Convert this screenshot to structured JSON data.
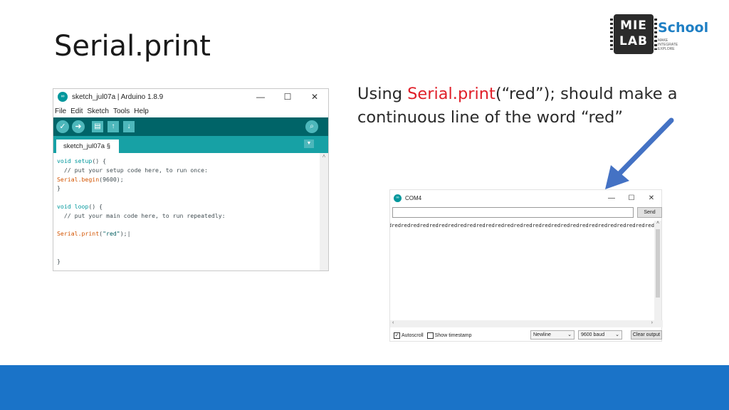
{
  "slide": {
    "title": "Serial.print",
    "description_prefix": "Using ",
    "description_highlight": "Serial.print",
    "description_suffix": "(“red”); should make a continuous line of the word “red”",
    "highlight_color": "#e0202a",
    "footer_color": "#1a73c8"
  },
  "logo": {
    "chip_line1": "MIE",
    "chip_line2": "LAB",
    "school": "School",
    "tagline": [
      "MAKE",
      "INTEGRATE",
      "EXPLORE"
    ]
  },
  "ide": {
    "window_title": "sketch_jul07a | Arduino 1.8.9",
    "menu": [
      "File",
      "Edit",
      "Sketch",
      "Tools",
      "Help"
    ],
    "toolbar_icons": [
      "verify-icon",
      "upload-icon",
      "new-icon",
      "open-icon",
      "save-icon",
      "serial-monitor-icon"
    ],
    "tab_label": "sketch_jul07a §",
    "code": {
      "l1_kw": "void",
      "l1_fn": "setup",
      "l1_rest": "() {",
      "l2": "  // put your setup code here, to run once:",
      "l3_fn": "Serial.begin",
      "l3_rest": "(9600);",
      "l4": "}",
      "l6_kw": "void",
      "l6_fn": "loop",
      "l6_rest": "() {",
      "l7": "  // put your main code here, to run repeatedly:",
      "l9_fn": "Serial.print",
      "l9_open": "(",
      "l9_str": "\"red\"",
      "l9_close": ");",
      "l12": "}"
    }
  },
  "serial_monitor": {
    "window_title": "COM4",
    "input_value": "",
    "send_label": "Send",
    "output": "edredredredredredredredredredredredredredredredredredredredredredredredredredredredred",
    "autoscroll_label": "Autoscroll",
    "autoscroll_checked": true,
    "timestamp_label": "Show timestamp",
    "timestamp_checked": false,
    "line_ending": "Newline",
    "baud": "9600 baud",
    "clear_label": "Clear output"
  },
  "colors": {
    "arduino_teal_dark": "#006468",
    "arduino_teal": "#17a1a5",
    "arrow_blue": "#4472c4"
  }
}
